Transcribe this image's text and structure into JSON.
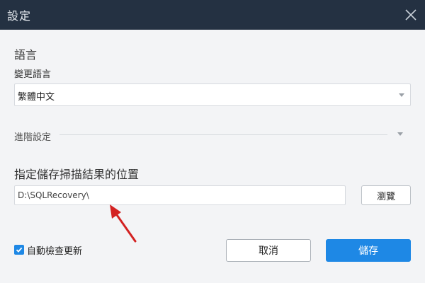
{
  "window": {
    "title": "設定",
    "close_icon": "close-icon"
  },
  "language": {
    "section_title": "語言",
    "change_label": "變更語言",
    "selected": "繁體中文"
  },
  "advanced": {
    "label": "進階設定"
  },
  "location": {
    "title": "指定儲存掃描結果的位置",
    "path": "D:\\SQLRecovery\\",
    "browse_label": "瀏覽"
  },
  "footer": {
    "auto_update_label": "自動檢查更新",
    "auto_update_checked": true,
    "cancel_label": "取消",
    "save_label": "儲存"
  },
  "colors": {
    "titlebar": "#243142",
    "accent": "#1e88e5",
    "background": "#f3f4f6"
  }
}
